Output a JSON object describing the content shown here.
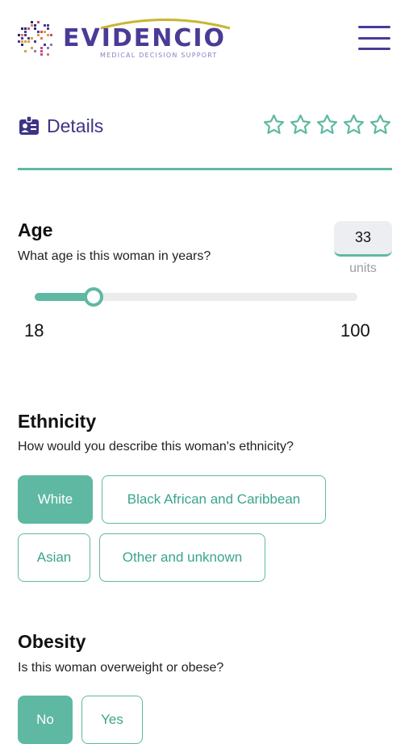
{
  "header": {
    "logo_word": "EVIDENCIO",
    "logo_tagline": "MEDICAL DECISION SUPPORT",
    "menu_icon": "hamburger-menu-icon",
    "brand_color": "#4b3a96",
    "accent_color": "#5fb8a2"
  },
  "details": {
    "label": "Details",
    "icon": "id-card-icon",
    "rating": {
      "max": 5,
      "filled": 0
    }
  },
  "age": {
    "title": "Age",
    "description": "What age is this woman in years?",
    "value": "33",
    "units": "units",
    "min": "18",
    "max": "100",
    "slider_value": 33
  },
  "ethnicity": {
    "title": "Ethnicity",
    "description": "How would you describe this woman's ethnicity?",
    "options": [
      "White",
      "Black African and Caribbean",
      "Asian",
      "Other and unknown"
    ],
    "selected": "White"
  },
  "obesity": {
    "title": "Obesity",
    "description": "Is this woman overweight or obese?",
    "options": [
      "No",
      "Yes"
    ],
    "selected": "No"
  }
}
